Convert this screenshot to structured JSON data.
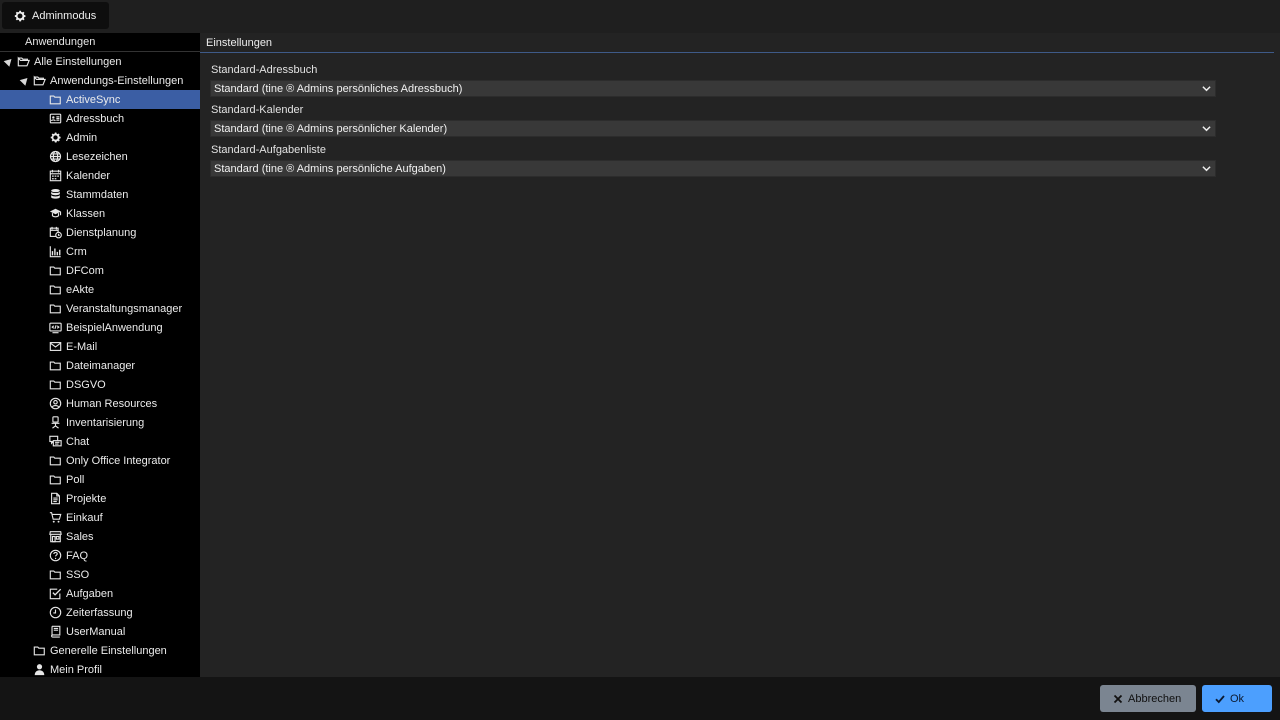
{
  "topbar": {
    "admin_label": "Adminmodus"
  },
  "sidebar": {
    "header": "Anwendungen",
    "items": [
      {
        "label": "Alle Einstellungen",
        "icon": "folder-open-icon",
        "level": 0,
        "expander": true
      },
      {
        "label": "Anwendungs-Einstellungen",
        "icon": "folder-open-icon",
        "level": 1,
        "expander": true
      },
      {
        "label": "ActiveSync",
        "icon": "folder-icon",
        "level": 2,
        "selected": true
      },
      {
        "label": "Adressbuch",
        "icon": "address-card-icon",
        "level": 2
      },
      {
        "label": "Admin",
        "icon": "gear-icon",
        "level": 2
      },
      {
        "label": "Lesezeichen",
        "icon": "globe-icon",
        "level": 2
      },
      {
        "label": "Kalender",
        "icon": "calendar-icon",
        "level": 2
      },
      {
        "label": "Stammdaten",
        "icon": "database-icon",
        "level": 2
      },
      {
        "label": "Klassen",
        "icon": "graduation-cap-icon",
        "level": 2
      },
      {
        "label": "Dienstplanung",
        "icon": "calendar-clock-icon",
        "level": 2
      },
      {
        "label": "Crm",
        "icon": "chart-icon",
        "level": 2
      },
      {
        "label": "DFCom",
        "icon": "folder-icon",
        "level": 2
      },
      {
        "label": "eAkte",
        "icon": "folder-icon",
        "level": 2
      },
      {
        "label": "Veranstaltungsmanager",
        "icon": "folder-icon",
        "level": 2
      },
      {
        "label": "BeispielAnwendung",
        "icon": "code-window-icon",
        "level": 2
      },
      {
        "label": "E-Mail",
        "icon": "envelope-icon",
        "level": 2
      },
      {
        "label": "Dateimanager",
        "icon": "folder-icon",
        "level": 2
      },
      {
        "label": "DSGVO",
        "icon": "folder-icon",
        "level": 2
      },
      {
        "label": "Human Resources",
        "icon": "user-circle-icon",
        "level": 2
      },
      {
        "label": "Inventarisierung",
        "icon": "office-chair-icon",
        "level": 2
      },
      {
        "label": "Chat",
        "icon": "chat-icon",
        "level": 2
      },
      {
        "label": "Only Office Integrator",
        "icon": "folder-icon",
        "level": 2
      },
      {
        "label": "Poll",
        "icon": "folder-icon",
        "level": 2
      },
      {
        "label": "Projekte",
        "icon": "document-icon",
        "level": 2
      },
      {
        "label": "Einkauf",
        "icon": "cart-icon",
        "level": 2
      },
      {
        "label": "Sales",
        "icon": "store-icon",
        "level": 2
      },
      {
        "label": "FAQ",
        "icon": "question-circle-icon",
        "level": 2
      },
      {
        "label": "SSO",
        "icon": "folder-icon",
        "level": 2
      },
      {
        "label": "Aufgaben",
        "icon": "checkbox-icon",
        "level": 2
      },
      {
        "label": "Zeiterfassung",
        "icon": "clock-icon",
        "level": 2
      },
      {
        "label": "UserManual",
        "icon": "book-icon",
        "level": 2
      },
      {
        "label": "Generelle Einstellungen",
        "icon": "folder-icon",
        "level": 1
      },
      {
        "label": "Mein Profil",
        "icon": "user-icon",
        "level": 1
      }
    ]
  },
  "main": {
    "header": "Einstellungen",
    "fields": [
      {
        "label": "Standard-Adressbuch",
        "value": "Standard (tine ® Admins persönliches Adressbuch)"
      },
      {
        "label": "Standard-Kalender",
        "value": "Standard (tine ® Admins persönlicher Kalender)"
      },
      {
        "label": "Standard-Aufgabenliste",
        "value": "Standard (tine ® Admins persönliche Aufgaben)"
      }
    ]
  },
  "footer": {
    "cancel_label": "Abbrechen",
    "ok_label": "Ok"
  },
  "colors": {
    "selected": "#3b5ea4",
    "ok_button": "#4c9ffe",
    "cancel_button": "#7b8591"
  }
}
